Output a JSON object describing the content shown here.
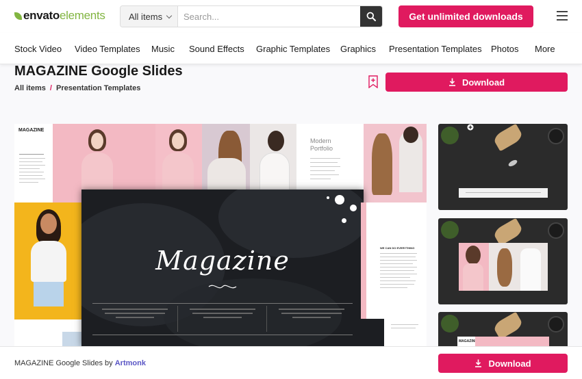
{
  "header": {
    "logo_main": "envato",
    "logo_suffix": "elements",
    "search_category": "All items",
    "search_placeholder": "Search...",
    "cta_label": "Get unlimited downloads"
  },
  "nav": {
    "items": [
      "Stock Video",
      "Video Templates",
      "Music",
      "Sound Effects",
      "Graphic Templates",
      "Graphics",
      "Presentation Templates",
      "Photos",
      "More"
    ]
  },
  "item": {
    "title": "MAGAZINE Google Slides",
    "breadcrumb_root": "All items",
    "breadcrumb_separator": "/",
    "breadcrumb_category": "Presentation Templates",
    "download_label": "Download"
  },
  "preview": {
    "brand_label": "MAGAZINE",
    "portfolio_line1": "Modern",
    "portfolio_line2": "Portfolio",
    "script_title": "Magazine",
    "side_heading": "WE CAN DO EVERYTHING",
    "thumb3_label": "MAGAZINE"
  },
  "footer": {
    "credit_prefix": "MAGAZINE Google Slides by",
    "author": "Artmonk",
    "download_label": "Download"
  },
  "colors": {
    "accent": "#e01a5f",
    "brand_green": "#82b541",
    "author_link": "#5a56c5"
  }
}
